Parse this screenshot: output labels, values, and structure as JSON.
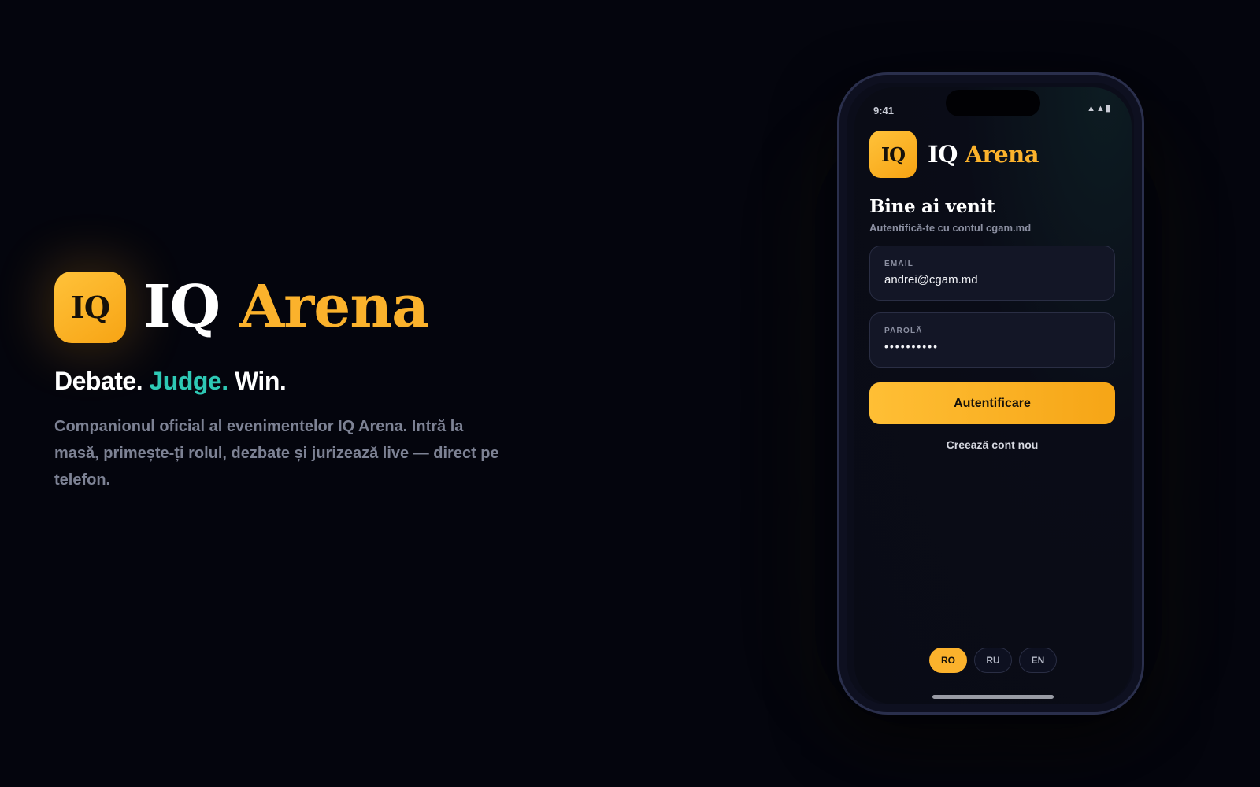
{
  "hero": {
    "logo_text": "IQ",
    "title_part1": "IQ",
    "title_part2": "Arena",
    "tagline": {
      "word1": "Debate.",
      "word2": "Judge.",
      "word3": "Win."
    },
    "description": "Companionul oficial al evenimentelor IQ Arena. Intră la masă, primește-ți rolul, dezbate și jurizează live — direct pe telefon."
  },
  "phone": {
    "status_time": "9:41",
    "status_icons": "▲▲▮",
    "app": {
      "logo_text": "IQ",
      "name_part1": "IQ",
      "name_part2": "Arena"
    },
    "welcome_title": "Bine ai venit",
    "welcome_subtitle": "Autentifică-te cu contul cgam.md",
    "email_field": {
      "label": "EMAIL",
      "value": "andrei@cgam.md"
    },
    "password_field": {
      "label": "PAROLĂ",
      "value": "••••••••••"
    },
    "login_button": "Autentificare",
    "create_account": "Creează cont nou",
    "languages": [
      {
        "code": "RO",
        "active": true
      },
      {
        "code": "RU",
        "active": false
      },
      {
        "code": "EN",
        "active": false
      }
    ]
  },
  "colors": {
    "background": "#04050d",
    "accent_orange": "#fbb22c",
    "accent_teal": "#2ec9b5",
    "muted_text": "#7d8294"
  }
}
